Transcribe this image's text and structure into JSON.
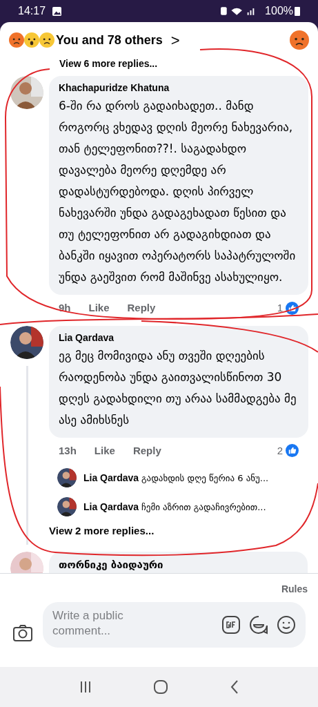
{
  "status_bar": {
    "time": "14:17",
    "battery": "100%"
  },
  "header": {
    "reactions_text": "You and 78 others",
    "chevron": ">"
  },
  "top_link": "View 6 more replies...",
  "comments": [
    {
      "author": "Khachapuridze Khatuna",
      "text": "6-ში რა დროს გადაიხადეთ.. მანდ როგორც ვხედავ დღის მეორე ნახევარია, თან ტელეფონით??!. საგადახდო დავალება მეორე დღემდე არ დადასტურდებოდა. დღის პირველ ნახევარში უნდა გადაგეხადათ წესით და თუ ტელეფონით არ გადაგიხდიათ და ბანკში იყავით ოპერატორს საპატრულოში უნდა გაეშვით რომ მაშინვე ასახულიყო.",
      "time": "9h",
      "like": "Like",
      "reply": "Reply",
      "like_count": "1"
    },
    {
      "author": "Lia Qardava",
      "text": "ეგ მეც მომივიდა ანუ თვეში დღეების რაოდენობა უნდა გაითვალისწინოთ 30 დღეს გადახდილი თუ არაა სამმადგება მე ასე ამიხსნეს",
      "time": "13h",
      "like": "Like",
      "reply": "Reply",
      "like_count": "2",
      "replies": [
        {
          "author": "Lia Qardava",
          "text": "გადახდის დღე წერია 6 ანუ..."
        },
        {
          "author": "Lia Qardava",
          "text": "ჩემი აზრით გადაჩივრებით..."
        }
      ],
      "more": "View 2 more replies..."
    }
  ],
  "partial_comment": {
    "author": "თორნიკე ბაიდაური"
  },
  "rules": "Rules",
  "composer": {
    "placeholder": "Write a public comment..."
  }
}
